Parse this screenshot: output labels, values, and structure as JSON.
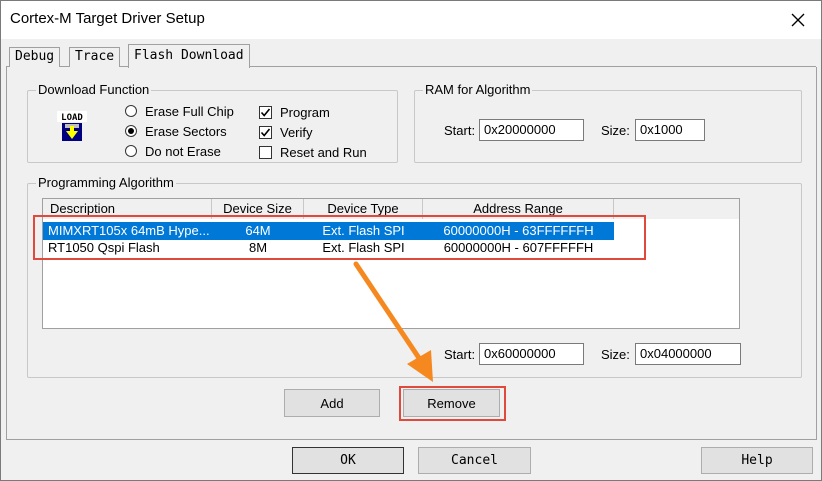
{
  "window": {
    "title": "Cortex-M Target Driver Setup"
  },
  "tabs": [
    {
      "label": "Debug"
    },
    {
      "label": "Trace"
    },
    {
      "label": "Flash Download"
    }
  ],
  "download_function": {
    "title": "Download Function",
    "icon_text": "LOAD",
    "options": [
      {
        "label": "Erase Full Chip",
        "selected": false
      },
      {
        "label": "Erase Sectors",
        "selected": true
      },
      {
        "label": "Do not Erase",
        "selected": false
      }
    ],
    "checks": [
      {
        "label": "Program",
        "checked": true
      },
      {
        "label": "Verify",
        "checked": true
      },
      {
        "label": "Reset and Run",
        "checked": false
      }
    ]
  },
  "ram": {
    "title": "RAM for Algorithm",
    "start_label": "Start:",
    "start_value": "0x20000000",
    "size_label": "Size:",
    "size_value": "0x1000"
  },
  "programming": {
    "title": "Programming Algorithm",
    "columns": [
      "Description",
      "Device Size",
      "Device Type",
      "Address Range"
    ],
    "rows": [
      {
        "description": "MIMXRT105x 64mB Hype...",
        "size": "64M",
        "type": "Ext. Flash SPI",
        "range": "60000000H - 63FFFFFFH",
        "selected": true
      },
      {
        "description": "RT1050 Qspi Flash",
        "size": "8M",
        "type": "Ext. Flash SPI",
        "range": "60000000H - 607FFFFFH",
        "selected": false
      }
    ],
    "start_label": "Start:",
    "start_value": "0x60000000",
    "size_label": "Size:",
    "size_value": "0x04000000",
    "add_label": "Add",
    "remove_label": "Remove"
  },
  "footer": {
    "ok_label": "OK",
    "cancel_label": "Cancel",
    "help_label": "Help"
  },
  "colors": {
    "selection": "#0078d7",
    "annotation": "#e04a3c",
    "arrow": "#f5891f"
  }
}
